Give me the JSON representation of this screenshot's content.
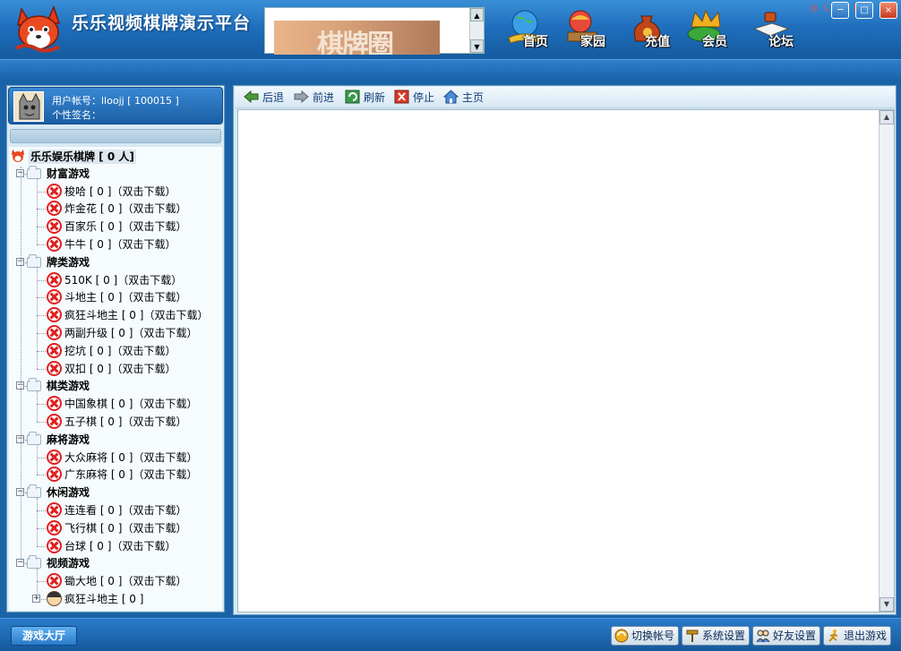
{
  "window": {
    "title": "乐乐视频棋牌演示平台",
    "title_tag": "◎ ＬＥＬＥ ◎",
    "ad_text": "棋牌圈",
    "controls": {
      "minimize": "─",
      "maximize": "□",
      "close": "×"
    }
  },
  "nav": [
    {
      "label": "首页",
      "icon": "globe-icon"
    },
    {
      "label": "家园",
      "icon": "home-icon"
    },
    {
      "label": "充值",
      "icon": "money-bag-icon"
    },
    {
      "label": "会员",
      "icon": "crown-icon"
    },
    {
      "label": "论坛",
      "icon": "book-icon"
    }
  ],
  "user": {
    "account": "用户帐号：lloojj [ 100015 ]",
    "signature": "个性签名："
  },
  "tree": {
    "root": "乐乐娱乐棋牌 [ 0 人]",
    "categories": [
      {
        "label": "财富游戏",
        "items": [
          "梭哈 [ 0 ]（双击下载）",
          "炸金花 [ 0 ]（双击下载）",
          "百家乐 [ 0 ]（双击下载）",
          "牛牛 [ 0 ]（双击下载）"
        ]
      },
      {
        "label": "牌类游戏",
        "items": [
          "510K [ 0 ]（双击下载）",
          "斗地主 [ 0 ]（双击下载）",
          "疯狂斗地主 [ 0 ]（双击下载）",
          "两副升级 [ 0 ]（双击下载）",
          "挖坑 [ 0 ]（双击下载）",
          "双扣 [ 0 ]（双击下载）"
        ]
      },
      {
        "label": "棋类游戏",
        "items": [
          "中国象棋 [ 0 ]（双击下载）",
          "五子棋 [ 0 ]（双击下载）"
        ]
      },
      {
        "label": "麻将游戏",
        "items": [
          "大众麻将 [ 0 ]（双击下载）",
          "广东麻将 [ 0 ]（双击下载）"
        ]
      },
      {
        "label": "休闲游戏",
        "items": [
          "连连看 [ 0 ]（双击下载）",
          "飞行棋 [ 0 ]（双击下载）",
          "台球 [ 0 ]（双击下载）"
        ]
      },
      {
        "label": "视频游戏",
        "items": [
          "锄大地 [ 0 ]（双击下载）",
          "疯狂斗地主 [ 0 ]"
        ]
      }
    ]
  },
  "browser": {
    "back": "后退",
    "forward": "前进",
    "refresh": "刷新",
    "stop": "停止",
    "home": "主页"
  },
  "bottom": {
    "lobby": "游戏大厅",
    "switch_account": "切换帐号",
    "settings": "系统设置",
    "friend_settings": "好友设置",
    "exit": "退出游戏"
  },
  "colors": {
    "header_blue": "#1f6fbd",
    "panel_bg": "#d8e9f3",
    "download_icon_red": "#e02020",
    "title_tag_red": "#ff4a3a"
  }
}
